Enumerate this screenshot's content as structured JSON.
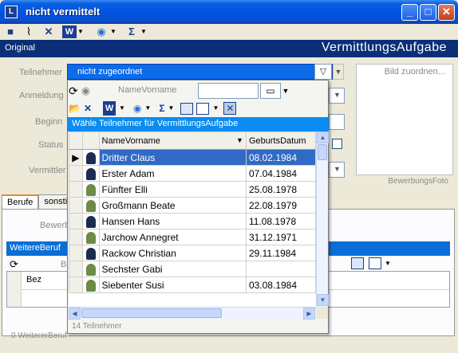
{
  "window": {
    "title": "nicht vermittelt",
    "app_icon": "app-icon"
  },
  "window_controls": {
    "minimize": "_",
    "maximize": "□",
    "close": "✕"
  },
  "toolbar": {
    "icons": [
      "save-icon",
      "attach-icon",
      "delete-icon",
      "word-icon",
      "globe-icon",
      "sum-icon"
    ]
  },
  "header": {
    "left": "Original",
    "right": "VermittlungsAufgabe"
  },
  "form": {
    "labels": {
      "teilnehmer": "Teilnehmer",
      "anmeldung": "Anmeldung",
      "beginn": "Beginn",
      "status": "Status",
      "vermittler": "Vermittler"
    },
    "photo_link": "Bild zuordnen...",
    "photo_caption": "BewerbungsFoto"
  },
  "tabs": [
    {
      "label": "Berufe",
      "active": true
    },
    {
      "label": "sonstig"
    }
  ],
  "lower": {
    "bewerb_label": "Bewerb",
    "weitere_band": "WeitereBeruf",
    "be_label": "Be",
    "bez_header": "Bez",
    "status": "0 WeitererBeruf"
  },
  "dropdown": {
    "selected_text": "nicht zugeordnet",
    "combo_placeholder": "NameVorname",
    "band": "Wähle Teilnehmer für VermittlungsAufgabe",
    "columns": [
      "NameVorname",
      "GeburtsDatum"
    ],
    "rows": [
      {
        "name": "Dritter Claus",
        "date": "08.02.1984",
        "gender": "m",
        "selected": true
      },
      {
        "name": "Erster Adam",
        "date": "07.04.1984",
        "gender": "m"
      },
      {
        "name": "Fünfter Elli",
        "date": "25.08.1978",
        "gender": "f"
      },
      {
        "name": "Großmann Beate",
        "date": "22.08.1979",
        "gender": "f"
      },
      {
        "name": "Hansen Hans",
        "date": "11.08.1978",
        "gender": "m"
      },
      {
        "name": "Jarchow Annegret",
        "date": "31.12.1971",
        "gender": "f"
      },
      {
        "name": "Rackow Christian",
        "date": "29.11.1984",
        "gender": "m"
      },
      {
        "name": "Sechster Gabi",
        "date": "",
        "gender": "f"
      },
      {
        "name": "Siebenter Susi",
        "date": "03.08.1984",
        "gender": "f"
      }
    ],
    "status": "14 Teilnehmer"
  },
  "colors": {
    "titlebar": "#0054e3",
    "band": "#0a2f78",
    "popup_band": "#0a8cf0",
    "selection": "#316ac5"
  }
}
